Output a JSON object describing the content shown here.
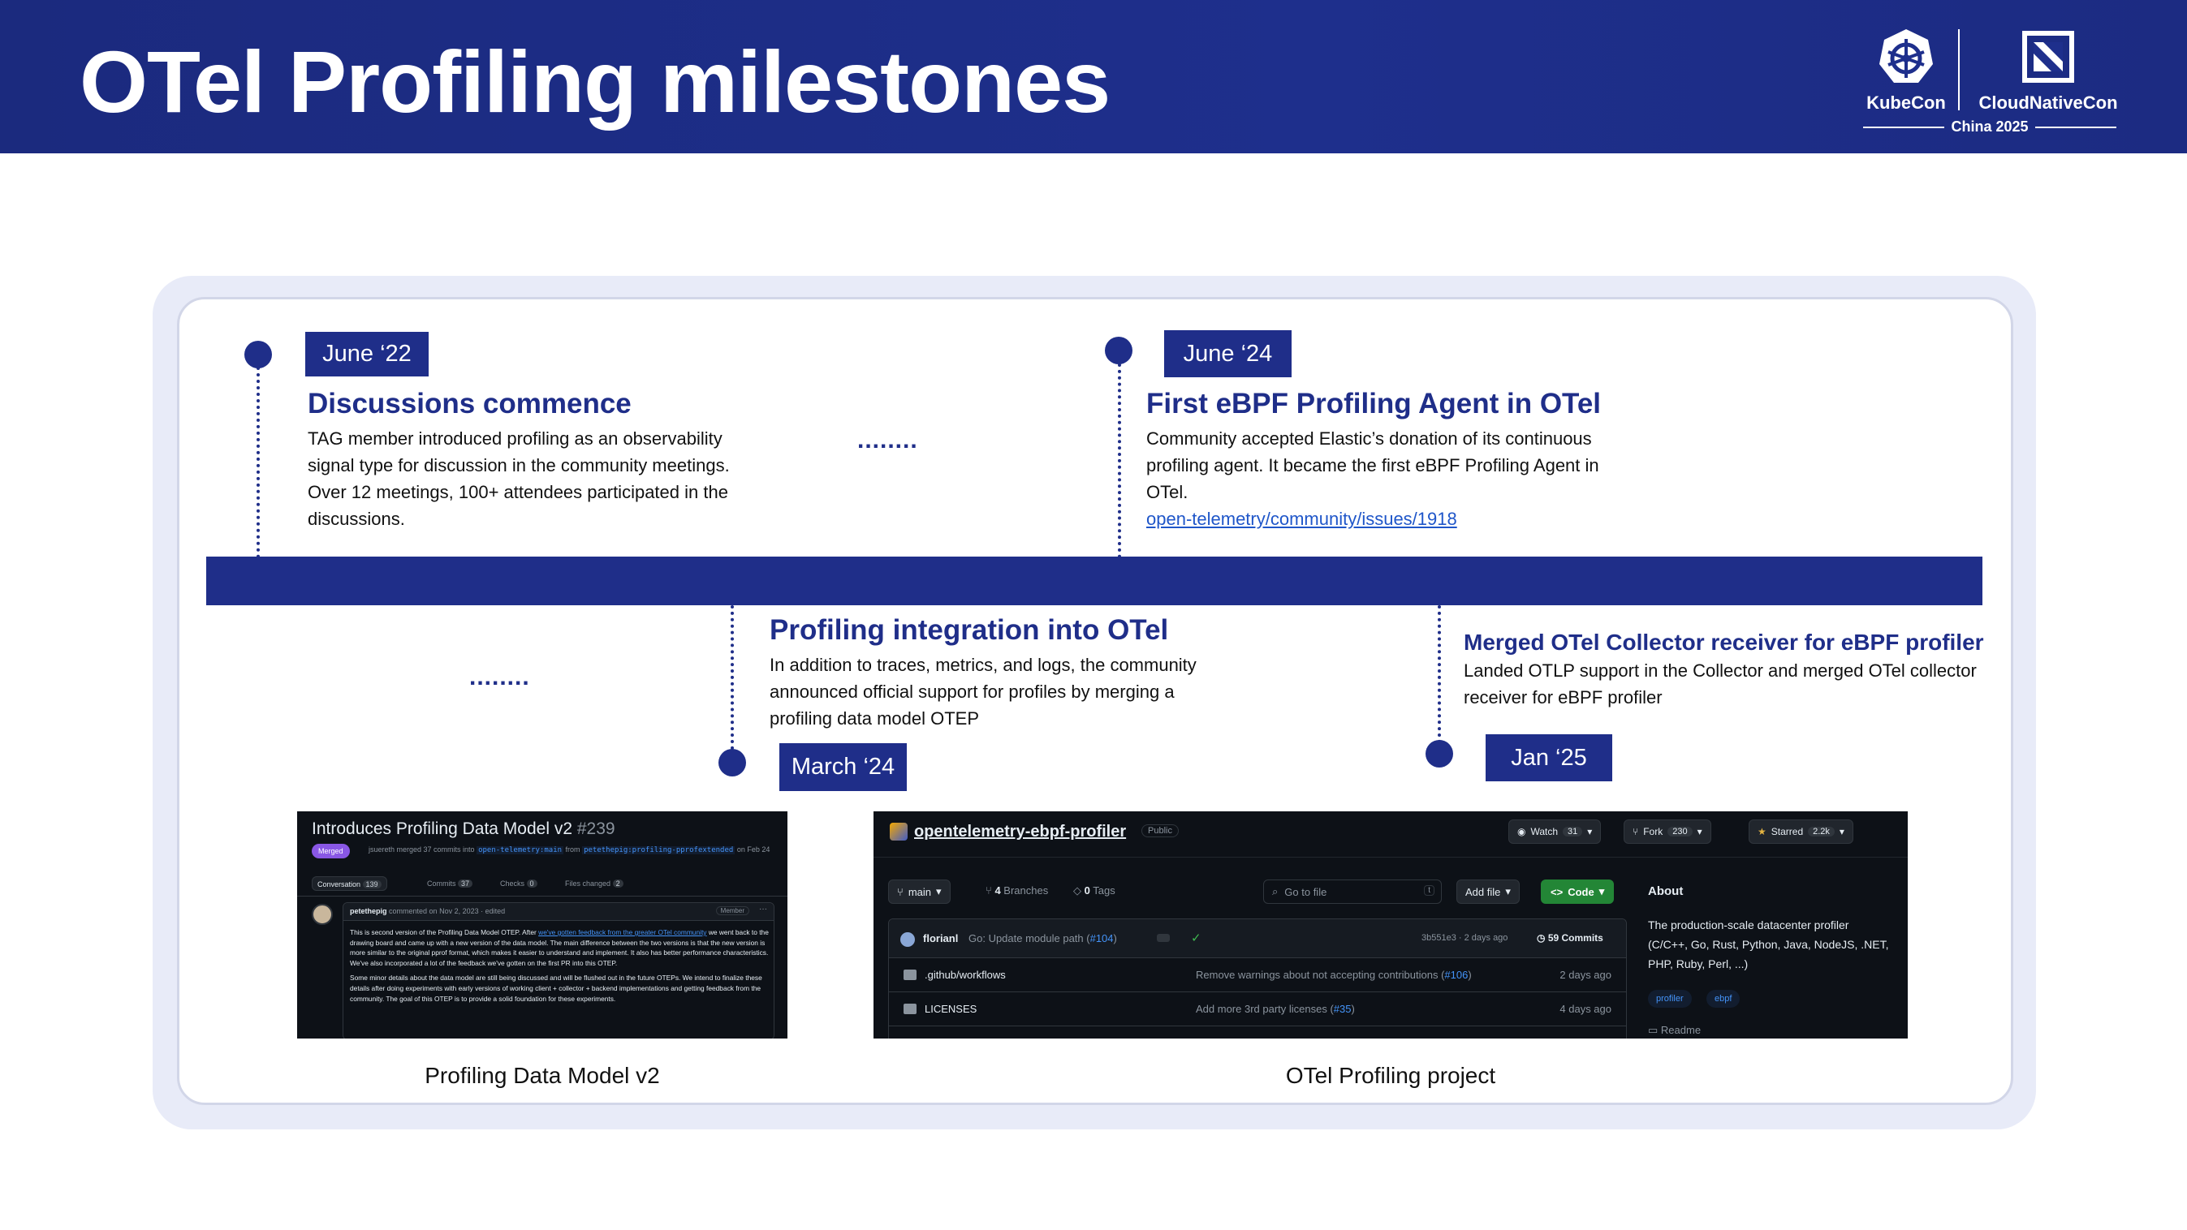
{
  "slide": {
    "title": "OTel Profiling milestones",
    "logo": {
      "kubecon": "KubeCon",
      "cloudnativecon": "CloudNativeCon",
      "event": "China 2025"
    }
  },
  "milestones": [
    {
      "date": "June ‘22",
      "title": "Discussions commence",
      "desc": "TAG member introduced profiling as an observability signal type for discussion in the community meetings. Over 12 meetings, 100+ attendees participated in the discussions."
    },
    {
      "date": "March ‘24",
      "title": "Profiling integration into OTel",
      "desc": "In addition to traces, metrics, and logs, the community announced official support for profiles by merging a profiling data model OTEP"
    },
    {
      "date": "June ‘24",
      "title": "First eBPF Profiling Agent in OTel",
      "desc": "Community accepted Elastic’s donation of its continuous profiling agent. It became the first eBPF Profiling Agent in OTel.",
      "link": "open-telemetry/community/issues/1918"
    },
    {
      "date": "Jan ‘25",
      "title": "Merged OTel Collector receiver for eBPF profiler",
      "desc": "Landed OTLP support in the Collector and merged OTel collector receiver for eBPF profiler"
    }
  ],
  "ellipsis": "........",
  "screenshots": {
    "pr": {
      "caption": "Profiling Data Model v2",
      "title": "Introduces Profiling Data Model v2",
      "number": "#239",
      "status": "Merged",
      "meta_prefix": "jsuereth merged 37 commits into",
      "base_branch": "open-telemetry:main",
      "meta_from": "from",
      "head_branch": "petethepig:profiling-pprofextended",
      "meta_suffix": "on Feb 24",
      "tabs": [
        {
          "label": "Conversation",
          "count": "139"
        },
        {
          "label": "Commits",
          "count": "37"
        },
        {
          "label": "Checks",
          "count": "0"
        },
        {
          "label": "Files changed",
          "count": "2"
        }
      ],
      "comment_author": "petethepig",
      "comment_meta": "commented on Nov 2, 2023 · edited",
      "comment_role": "Member",
      "comment_p1_a": "This is second version of the Profiling Data Model OTEP. After ",
      "comment_p1_link": "we've gotten feedback from the greater OTel community",
      "comment_p1_b": " we went back to the drawing board and came up with a new version of the data model. The main difference between the two versions is that the new version is more similar to the original pprof format, which makes it easier to understand and implement. It also has better performance characteristics. We've also incorporated a lot of the feedback we've gotten on the first PR into this OTEP.",
      "comment_p2": "Some minor details about the data model are still being discussed and will be flushed out in the future OTEPs. We intend to finalize these details after doing experiments with early versions of working client + collector + backend implementations and getting feedback from the community. The goal of this OTEP is to provide a solid foundation for these experiments."
    },
    "repo": {
      "caption": "OTel Profiling project",
      "name": "opentelemetry-ebpf-profiler",
      "visibility": "Public",
      "watch_label": "Watch",
      "watch_count": "31",
      "fork_label": "Fork",
      "fork_count": "230",
      "star_label": "Starred",
      "star_count": "2.2k",
      "branch": "main",
      "branches_count": "4",
      "branches_label": "Branches",
      "tags_count": "0",
      "tags_label": "Tags",
      "search_placeholder": "Go to file",
      "search_kbd": "t",
      "add_file": "Add file",
      "code": "Code",
      "commit_author": "florianl",
      "commit_msg": "Go: Update module path (",
      "commit_pr": "#104",
      "commit_msg_end": ")",
      "commit_hash": "3b551e3 · 2 days ago",
      "commits_count": "59 Commits",
      "files": [
        {
          "name": ".github/workflows",
          "msg": "Remove warnings about not accepting contributions (",
          "pr": "#106",
          "msg_end": ")",
          "age": "2 days ago"
        },
        {
          "name": "LICENSES",
          "msg": "Add more 3rd party licenses (",
          "pr": "#35",
          "msg_end": ")",
          "age": "4 days ago"
        }
      ],
      "about_title": "About",
      "about_desc": "The production-scale datacenter profiler (C/C++, Go, Rust, Python, Java, NodeJS, .NET, PHP, Ruby, Perl, ...)",
      "topics": [
        "profiler",
        "ebpf"
      ],
      "readme": "Readme"
    }
  },
  "colors": {
    "brand_navy": "#1f2e89",
    "header_bg": "#1e2f8c",
    "card_border": "#e8ebf8",
    "link": "#1f56c9",
    "github_bg": "#0d1117",
    "github_green": "#238636",
    "merged_purple": "#8957e5"
  },
  "icons": [
    "kubernetes-helm-icon",
    "cncf-icon",
    "timeline-dot-icon",
    "branch-icon",
    "tag-icon",
    "search-icon",
    "code-icon",
    "eye-icon",
    "fork-icon",
    "star-icon",
    "folder-icon",
    "clock-icon",
    "book-icon",
    "check-icon"
  ]
}
